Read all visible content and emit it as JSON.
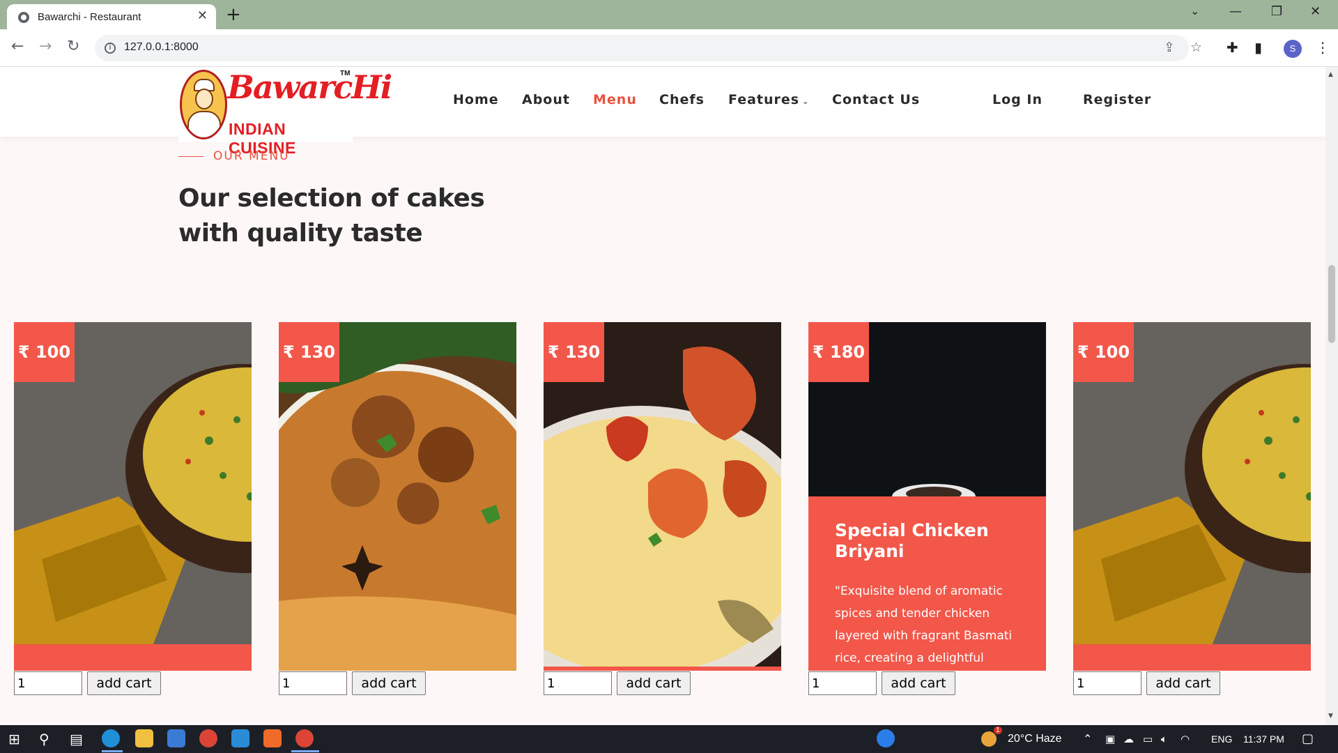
{
  "browser": {
    "tab_title": "Bawarchi - Restaurant",
    "tab_close": "✕",
    "new_tab": "+",
    "url": "127.0.0.1:8000",
    "profile_initial": "S",
    "icons": [
      "back-icon",
      "forward-icon",
      "reload-icon",
      "info-icon",
      "share-icon",
      "star-icon",
      "extensions-icon",
      "sidepanel-icon",
      "profile-avatar",
      "menu-icon"
    ]
  },
  "header": {
    "logo_word": "BawarcHi",
    "logo_tm": "TM",
    "logo_sub": "INDIAN CUISINE",
    "nav": [
      {
        "label": "Home"
      },
      {
        "label": "About"
      },
      {
        "label": "Menu",
        "active": true
      },
      {
        "label": "Chefs"
      },
      {
        "label": "Features",
        "has_dropdown": true
      },
      {
        "label": "Contact Us"
      }
    ],
    "login": "Log In",
    "register": "Register"
  },
  "menu_section": {
    "subtitle": "OUR MENU",
    "headline_line1": "Our selection of cakes",
    "headline_line2": "with quality taste"
  },
  "cards": [
    {
      "price": "₹ 100",
      "qty": "1",
      "button": "add cart",
      "image": "yellow-rice-bowl"
    },
    {
      "price": "₹ 130",
      "qty": "1",
      "button": "add cart",
      "image": "chicken-biryani"
    },
    {
      "price": "₹ 130",
      "qty": "1",
      "button": "add cart",
      "image": "biryani-plate"
    },
    {
      "price": "₹ 180",
      "qty": "1",
      "button": "add cart",
      "image": "dark-plate",
      "title": "Special Chicken Briyani",
      "description": "\"Exquisite blend of aromatic spices and tender chicken layered with fragrant Basmati rice, creating a delightful"
    },
    {
      "price": "₹ 100",
      "qty": "1",
      "button": "add cart",
      "image": "yellow-rice-bowl"
    }
  ],
  "taskbar": {
    "weather": "20°C  Haze",
    "language": "ENG",
    "time": "11:37 PM",
    "notification_badge": "1"
  },
  "colors": {
    "accent": "#e8523f",
    "card_red": "#f2574a",
    "chrome_frame": "#9fb59b",
    "page_bg": "#fdf8f7"
  }
}
